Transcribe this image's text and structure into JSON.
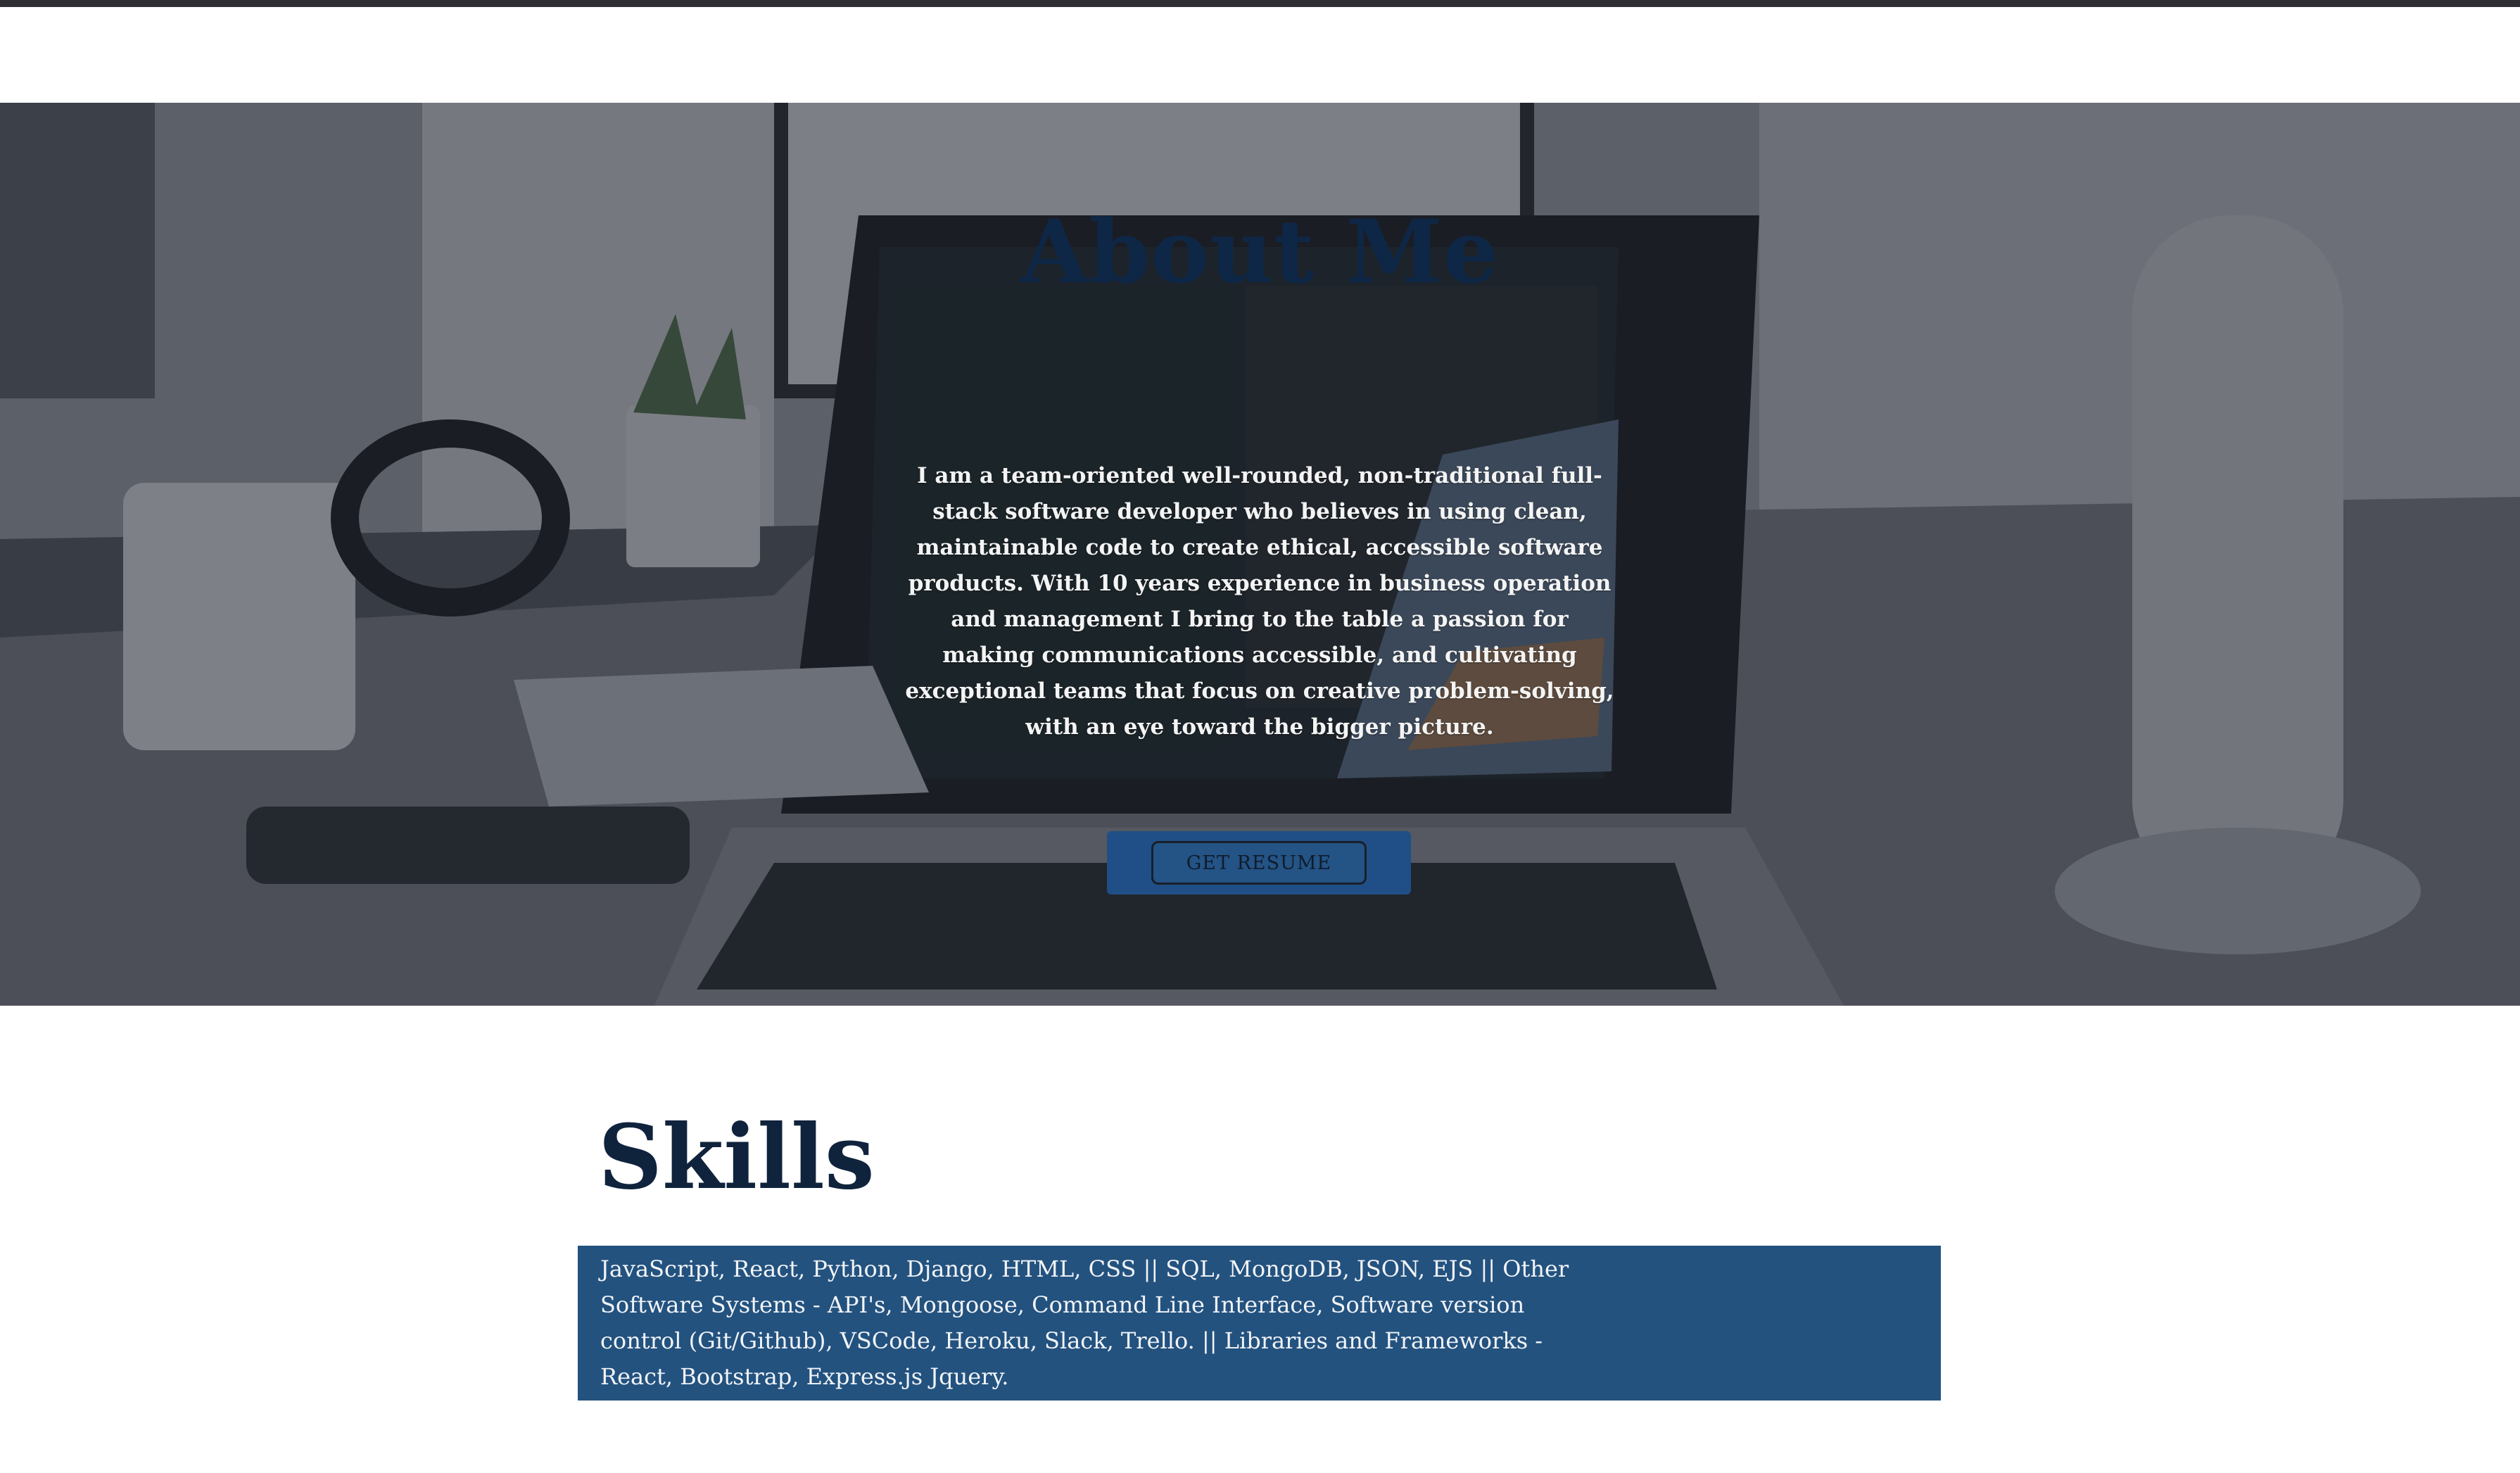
{
  "about": {
    "title": "About Me",
    "description": "I am a team-oriented well-rounded, non-traditional full-stack software developer who believes in using clean, maintainable code to create ethical, accessible software products. With 10 years experience in business operation and management I bring to the table a passion for making communications accessible, and cultivating exceptional teams that focus on creative problem-solving, with an eye toward the bigger picture.",
    "resume_button_label": "GET RESUME",
    "background_image": "desk-laptop-code-photo"
  },
  "skills": {
    "title": "Skills",
    "description": "JavaScript, React, Python, Django, HTML, CSS || SQL, MongoDB, JSON, EJS || Other Software Systems - API's, Mongoose, Command Line Interface, Software version control (Git/Github), VSCode, Heroku, Slack, Trello. || Libraries and Frameworks - React, Bootstrap, Express.js Jquery."
  },
  "colors": {
    "title_navy": "#0f2746",
    "skills_box": "#23527f",
    "resume_button_bg": "#1f4f86",
    "top_bar": "#2f2f33"
  }
}
